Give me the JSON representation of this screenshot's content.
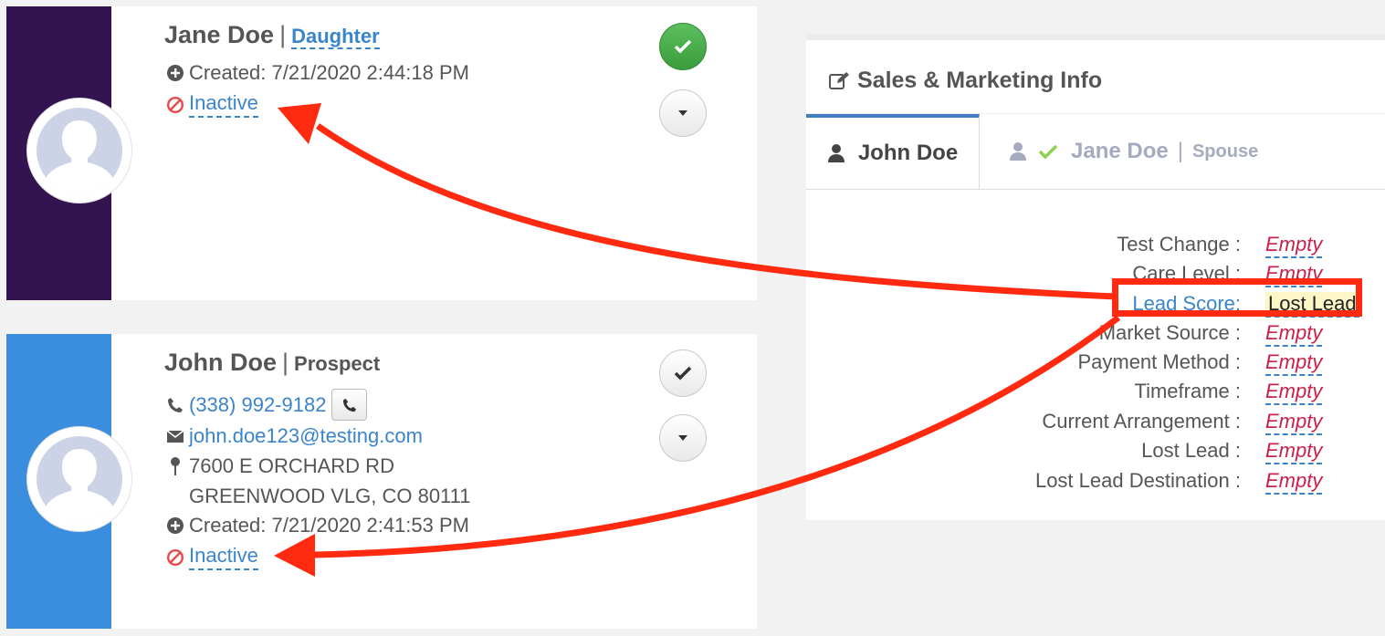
{
  "contacts": [
    {
      "name": "Jane Doe",
      "separator": "|",
      "relationship": "Daughter",
      "created": "Created: 7/21/2020 2:44:18 PM",
      "status": "Inactive",
      "stripe_color": "#331450",
      "check_state": "checked"
    },
    {
      "name": "John Doe",
      "separator": "|",
      "relationship": "Prospect",
      "phone": "(338) 992-9182",
      "email": "john.doe123@testing.com",
      "address_line1": "7600 E ORCHARD RD",
      "address_line2": "GREENWOOD VLG, CO 80111",
      "created": "Created: 7/21/2020 2:41:53 PM",
      "status": "Inactive",
      "stripe_color": "#3b8ede",
      "check_state": "unchecked"
    }
  ],
  "panel": {
    "title": "Sales & Marketing Info",
    "tabs": [
      {
        "label": "John Doe",
        "active": true
      },
      {
        "label": "Jane Doe",
        "separator": "|",
        "sublabel": "Spouse",
        "active": false
      }
    ],
    "fields": [
      {
        "label": "Test Change :",
        "value": "Empty"
      },
      {
        "label": "Care Level :",
        "value": "Empty"
      },
      {
        "label": "Lead Score:",
        "value": "Lost Lead",
        "highlighted": true
      },
      {
        "label": "Market Source :",
        "value": "Empty"
      },
      {
        "label": "Payment Method :",
        "value": "Empty"
      },
      {
        "label": "Timeframe :",
        "value": "Empty"
      },
      {
        "label": "Current Arrangement :",
        "value": "Empty"
      },
      {
        "label": "Lost Lead :",
        "value": "Empty"
      },
      {
        "label": "Lost Lead Destination :",
        "value": "Empty"
      }
    ]
  },
  "colors": {
    "link": "#3a84cc",
    "empty_value": "#cc1f4a",
    "annotation": "#ff2a0f",
    "tab_active": "#3f7dc4"
  },
  "icons": [
    "plus-circle-icon",
    "ban-icon",
    "check-icon",
    "caret-down-icon",
    "phone-icon",
    "envelope-icon",
    "map-pin-icon",
    "edit-icon",
    "user-icon",
    "user-silhouette-icon"
  ]
}
